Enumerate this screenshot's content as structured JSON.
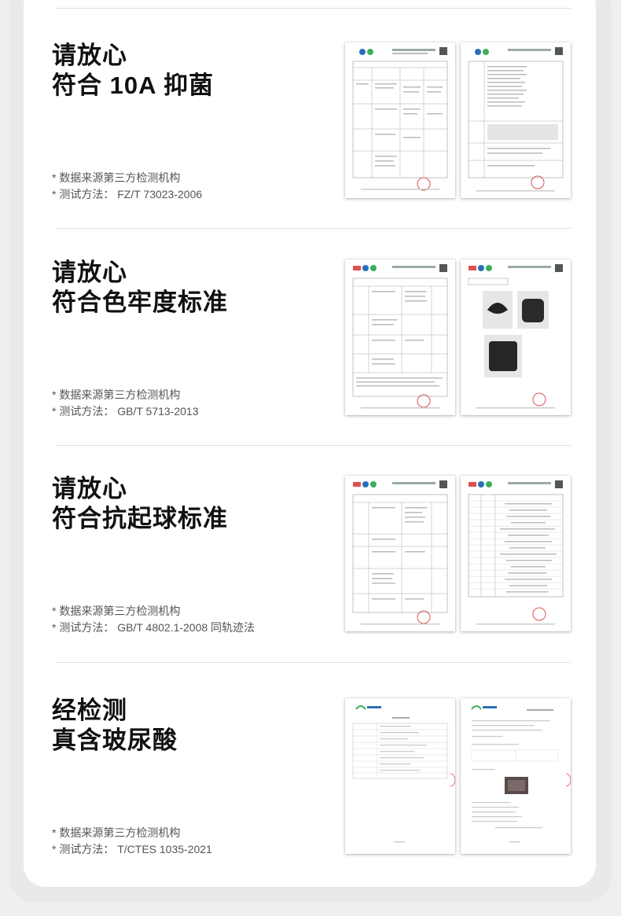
{
  "sections": [
    {
      "title_line1": "请放心",
      "title_line2": "符合 10A 抑菌",
      "note_source": "* 数据来源第三方检测机构",
      "note_method": "* 测试方法：  FZ/T 73023-2006"
    },
    {
      "title_line1": "请放心",
      "title_line2": "符合色牢度标准",
      "note_source": "* 数据来源第三方检测机构",
      "note_method": "* 测试方法：  GB/T 5713-2013"
    },
    {
      "title_line1": "请放心",
      "title_line2": "符合抗起球标准",
      "note_source": "* 数据来源第三方检测机构",
      "note_method": "* 测试方法：  GB/T 4802.1-2008 同轨迹法"
    },
    {
      "title_line1": "经检测",
      "title_line2": "真含玻尿酸",
      "note_source": "* 数据来源第三方检测机构",
      "note_method": "* 测试方法：  T/CTES 1035-2021"
    }
  ],
  "colors": {
    "stamp": "#d9534f",
    "logo_blue": "#2a6fb5",
    "logo_green": "#3cae5a"
  }
}
